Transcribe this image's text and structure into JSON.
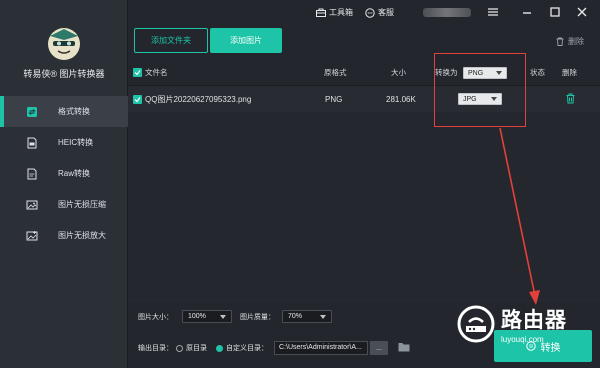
{
  "sidebar": {
    "brand": "转易侠® 图片转换器",
    "items": [
      {
        "label": "格式转换",
        "icon": "convert-icon",
        "active": true
      },
      {
        "label": "HEIC转换",
        "icon": "heic-file-icon",
        "active": false
      },
      {
        "label": "Raw转换",
        "icon": "raw-file-icon",
        "active": false
      },
      {
        "label": "图片无损压缩",
        "icon": "image-compress-icon",
        "active": false
      },
      {
        "label": "图片无损放大",
        "icon": "image-enlarge-icon",
        "active": false
      }
    ]
  },
  "titlebar": {
    "toolbox": "工具箱",
    "service": "客服"
  },
  "toolbar": {
    "add_folder": "添加文件夹",
    "add_image": "添加图片",
    "delete": "删除"
  },
  "table": {
    "headers": {
      "filename": "文件名",
      "format": "原格式",
      "size": "大小",
      "convert_to": "转换为",
      "status": "状态",
      "delete": "删除"
    },
    "convert_to_all": "PNG",
    "rows": [
      {
        "filename": "QQ图片20220627095323.png",
        "format": "PNG",
        "size": "281.06K",
        "convert_to": "JPG",
        "status": ""
      }
    ]
  },
  "options": {
    "image_size_label": "图片大小：",
    "image_size_value": "100%",
    "image_quality_label": "图片质量：",
    "image_quality_value": "70%"
  },
  "output": {
    "label": "输出目录：",
    "option_original": "原目录",
    "option_custom": "自定义目录：",
    "path": "C:\\Users\\Administrator\\A...",
    "browse": "...",
    "convert_button": "转换"
  },
  "watermark": {
    "title": "路由器",
    "subtitle": "luyouqi.com"
  },
  "colors": {
    "accent": "#1ec4a8",
    "highlight": "#e1413a"
  }
}
